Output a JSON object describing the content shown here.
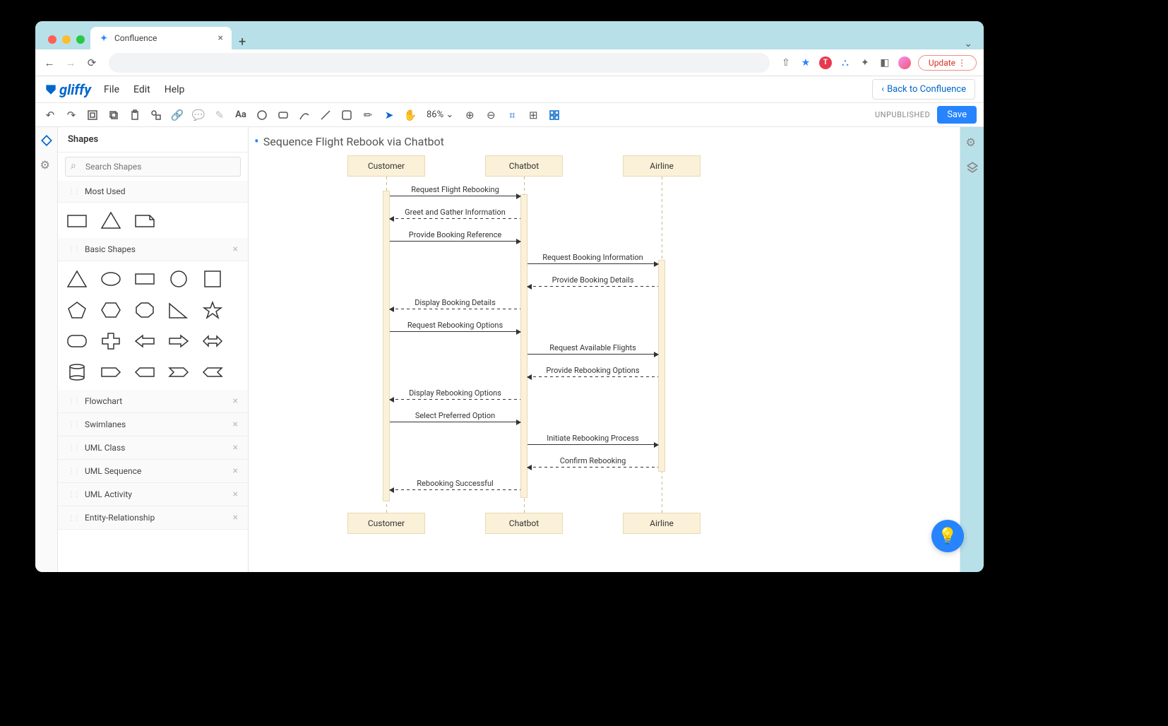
{
  "browser": {
    "tab_title": "Confluence",
    "update_label": "Update"
  },
  "app": {
    "logo_text": "gliffy",
    "menu": {
      "file": "File",
      "edit": "Edit",
      "help": "Help"
    },
    "back_label": "Back to Confluence",
    "zoom": "86%",
    "status": "UNPUBLISHED",
    "save_label": "Save"
  },
  "panel": {
    "title": "Shapes",
    "search_placeholder": "Search Shapes",
    "sections": {
      "most_used": "Most Used",
      "basic_shapes": "Basic Shapes",
      "flowchart": "Flowchart",
      "swimlanes": "Swimlanes",
      "uml_class": "UML Class",
      "uml_sequence": "UML Sequence",
      "uml_activity": "UML Activity",
      "entity_relationship": "Entity-Relationship"
    }
  },
  "document": {
    "title": "Sequence Flight Rebook via Chatbot"
  },
  "diagram": {
    "participants": {
      "customer": "Customer",
      "chatbot": "Chatbot",
      "airline": "Airline"
    },
    "messages": {
      "m1": "Request Flight Rebooking",
      "m2": "Greet and Gather Information",
      "m3": "Provide Booking Reference",
      "m4": "Request Booking Information",
      "m5": "Provide Booking Details",
      "m6": "Display Booking Details",
      "m7": "Request Rebooking Options",
      "m8": "Request Available Flights",
      "m9": "Provide Rebooking Options",
      "m10": "Display Rebooking Options",
      "m11": "Select Preferred Option",
      "m12": "Initiate Rebooking Process",
      "m13": "Confirm Rebooking",
      "m14": "Rebooking Successful"
    }
  }
}
